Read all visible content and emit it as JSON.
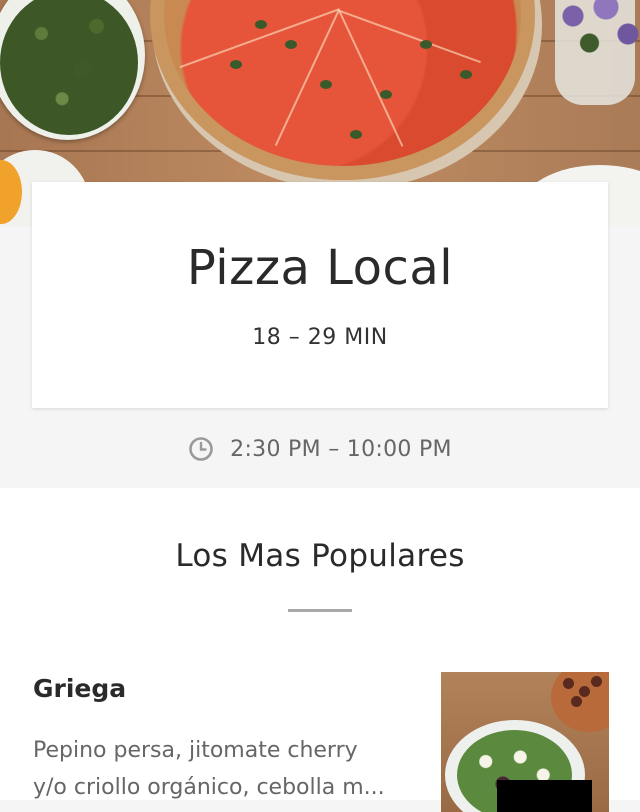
{
  "restaurant": {
    "name": "Pizza Local",
    "delivery_time": "18 – 29 MIN",
    "hours": "2:30 PM – 10:00 PM"
  },
  "icons": {
    "clock": "clock-icon"
  },
  "popular": {
    "title": "Los Mas Populares",
    "items": [
      {
        "name": "Griega",
        "description_lines": [
          "Pepino persa, jitomate cherry",
          "y/o criollo orgánico, cebolla m..."
        ]
      }
    ]
  },
  "colors": {
    "background": "#f5f5f5",
    "card": "#ffffff",
    "text_primary": "#2a2a2a",
    "text_secondary": "#666666"
  }
}
